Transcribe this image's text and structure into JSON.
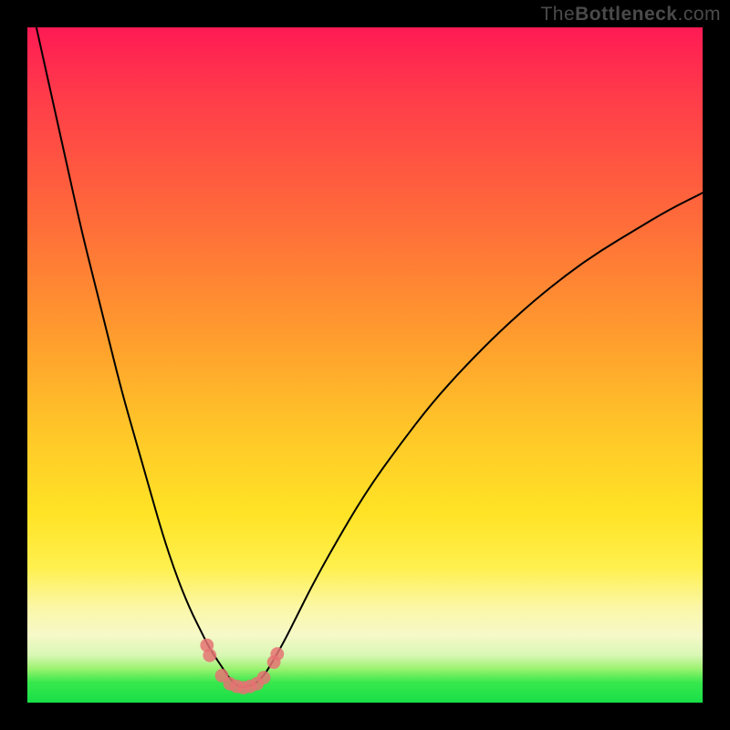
{
  "watermark": {
    "prefix": "The",
    "bold": "Bottleneck",
    "suffix": ".com"
  },
  "colors": {
    "frame": "#000000",
    "curve": "#000000",
    "dot": "#e57373",
    "gradient_stops": [
      "#ff1a54",
      "#ff3b4a",
      "#ff6a3a",
      "#ff9a2e",
      "#ffc728",
      "#ffe326",
      "#fff04e",
      "#fbf7a8",
      "#f6f9c8",
      "#d8f7b4",
      "#9af26f",
      "#37e84d",
      "#18df47"
    ]
  },
  "chart_data": {
    "type": "line",
    "title": "",
    "xlabel": "",
    "ylabel": "",
    "xlim": [
      0,
      100
    ],
    "ylim": [
      0,
      100
    ],
    "grid": false,
    "legend": "none",
    "notes": "Values in percent of plot area. y = 0 is top edge (worst / red), y = 100 is bottom edge (best / green). Curve is a V-shaped bottleneck plot: near 100 at the minimum (around x≈31), rising sharply toward 0 on the left and more gently on the right.",
    "x": [
      0,
      2,
      4,
      6,
      8,
      10,
      12,
      14,
      16,
      18,
      20,
      22,
      24,
      26,
      27,
      28,
      29,
      30,
      31,
      32,
      33,
      34,
      35,
      36,
      38,
      40,
      42,
      45,
      50,
      55,
      60,
      65,
      70,
      75,
      80,
      85,
      90,
      95,
      100
    ],
    "y": [
      -6,
      3,
      12,
      21,
      30,
      38,
      46,
      54,
      61,
      68,
      75,
      81,
      86,
      90,
      92,
      93.5,
      95,
      96.5,
      97.5,
      97.8,
      97.5,
      97,
      96,
      94.5,
      91,
      87,
      83,
      77.5,
      69,
      62,
      55.5,
      50,
      45,
      40.5,
      36.5,
      33,
      30,
      27,
      24.5
    ],
    "minimum": {
      "x": 31.5,
      "y_percent": 97.8
    },
    "dots_xy": [
      [
        26.6,
        91.5
      ],
      [
        27.0,
        93.0
      ],
      [
        28.8,
        96.0
      ],
      [
        30.0,
        97.2
      ],
      [
        31.0,
        97.6
      ],
      [
        32.0,
        97.8
      ],
      [
        33.0,
        97.6
      ],
      [
        34.0,
        97.2
      ],
      [
        35.0,
        96.3
      ],
      [
        36.5,
        94.0
      ],
      [
        37.0,
        92.8
      ]
    ],
    "dot_radius_pct": 1.0
  }
}
